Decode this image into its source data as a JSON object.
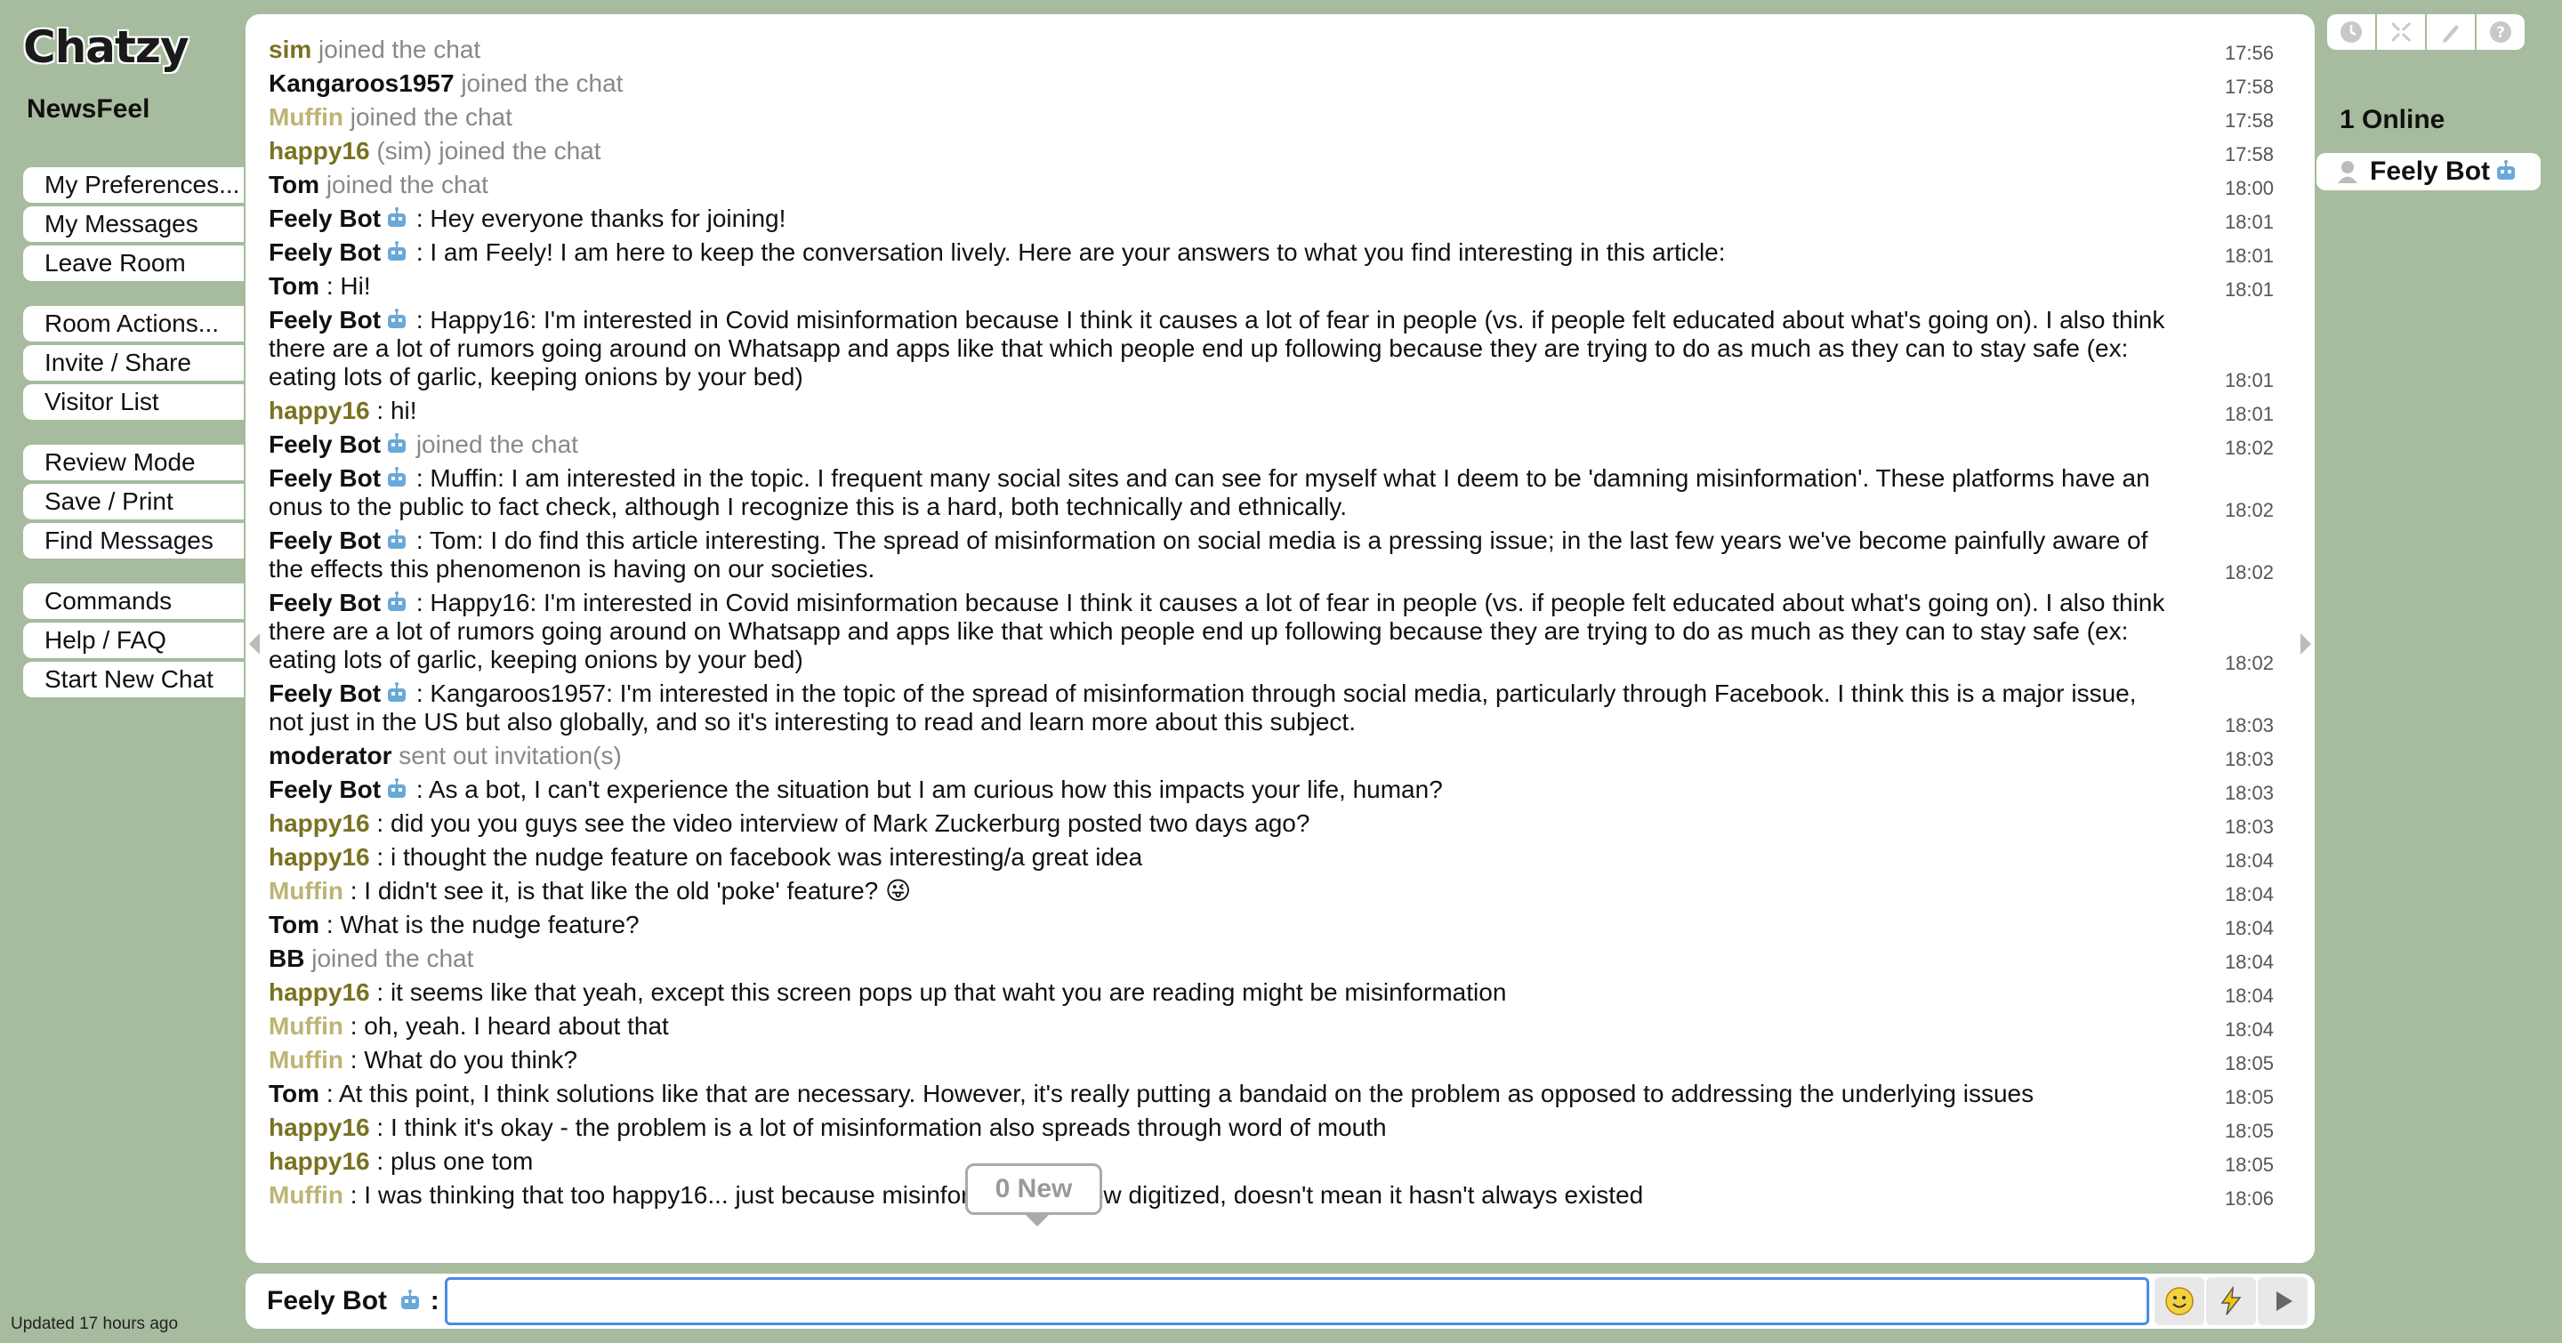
{
  "app": {
    "logo": "Chatzy",
    "room_name": "NewsFeel",
    "updated": "Updated 17 hours ago"
  },
  "sidebar": {
    "groups": [
      [
        "My Preferences...",
        "My Messages",
        "Leave Room"
      ],
      [
        "Room Actions...",
        "Invite / Share",
        "Visitor List"
      ],
      [
        "Review Mode",
        "Save / Print",
        "Find Messages"
      ],
      [
        "Commands",
        "Help / FAQ",
        "Start New Chat"
      ]
    ]
  },
  "chat": {
    "messages": [
      {
        "name": "sim",
        "cls": "n-sim",
        "text": "joined the chat",
        "system": true,
        "time": "17:56"
      },
      {
        "name": "Kangaroos1957",
        "cls": "n-kang",
        "text": "joined the chat",
        "system": true,
        "time": "17:58"
      },
      {
        "name": "Muffin",
        "cls": "n-muffin",
        "text": "joined the chat",
        "system": true,
        "time": "17:58"
      },
      {
        "name": "happy16",
        "cls": "n-happy16",
        "text": "(sim) joined the chat",
        "system": true,
        "time": "17:58"
      },
      {
        "name": "Tom",
        "cls": "n-tom",
        "text": "joined the chat",
        "system": true,
        "time": "18:00"
      },
      {
        "name": "Feely Bot",
        "cls": "bot",
        "bot": true,
        "text": " : Hey everyone thanks for joining!",
        "time": "18:01"
      },
      {
        "name": "Feely Bot",
        "cls": "bot",
        "bot": true,
        "text": " : I am Feely! I am here to keep the conversation lively. Here are your answers to what you find interesting in this article:",
        "time": "18:01"
      },
      {
        "name": "Tom",
        "cls": "n-tom",
        "text": ": Hi!",
        "time": "18:01"
      },
      {
        "name": "Feely Bot",
        "cls": "bot",
        "bot": true,
        "text": " : Happy16: I'm interested in Covid misinformation because I think it causes a lot of fear in people (vs. if people felt educated about what's going on). I also think there are a lot of rumors going around on Whatsapp and apps like that which people end up following because they are trying to do as much as they can to stay safe (ex: eating lots of garlic, keeping onions by your bed)",
        "time": "18:01"
      },
      {
        "name": "happy16",
        "cls": "n-happy16",
        "text": ": hi!",
        "time": "18:01"
      },
      {
        "name": "Feely Bot",
        "cls": "bot",
        "bot": true,
        "text": " joined the chat",
        "system": true,
        "time": "18:02"
      },
      {
        "name": "Feely Bot",
        "cls": "bot",
        "bot": true,
        "text": " : Muffin: I am interested in the topic. I frequent many social sites and can see for myself what I deem to be 'damning misinformation'. These platforms have an onus to the public to fact check, although I recognize this is a hard, both technically and ethnically.",
        "time": "18:02"
      },
      {
        "name": "Feely Bot",
        "cls": "bot",
        "bot": true,
        "text": " : Tom: I do find this article interesting. The spread of misinformation on social media is a pressing issue; in the last few years we've become painfully aware of the effects this phenomenon is having on our societies.",
        "time": "18:02"
      },
      {
        "name": "Feely Bot",
        "cls": "bot",
        "bot": true,
        "text": " : Happy16: I'm interested in Covid misinformation because I think it causes a lot of fear in people (vs. if people felt educated about what's going on). I also think there are a lot of rumors going around on Whatsapp and apps like that which people end up following because they are trying to do as much as they can to stay safe (ex: eating lots of garlic, keeping onions by your bed)",
        "time": "18:02"
      },
      {
        "name": "Feely Bot",
        "cls": "bot",
        "bot": true,
        "text": " : Kangaroos1957: I'm interested in the topic of the spread of misinformation through social media, particularly through Facebook. I think this is a major issue, not just in the US but also globally, and so it's interesting to read and learn more about this subject.",
        "time": "18:03"
      },
      {
        "name": "moderator",
        "cls": "n-mod",
        "text": "sent out invitation(s)",
        "system": true,
        "time": "18:03"
      },
      {
        "name": "Feely Bot",
        "cls": "bot",
        "bot": true,
        "text": " : As a bot, I can't experience the situation but I am curious how this impacts your life, human?",
        "time": "18:03"
      },
      {
        "name": "happy16",
        "cls": "n-happy16",
        "text": ": did you you guys see the video interview of Mark Zuckerburg posted two days ago?",
        "time": "18:03"
      },
      {
        "name": "happy16",
        "cls": "n-happy16",
        "text": ": i thought the nudge feature on facebook was interesting/a great idea",
        "time": "18:04"
      },
      {
        "name": "Muffin",
        "cls": "n-muffin",
        "text": ": I didn't see it, is that like the old 'poke' feature? 😜",
        "time": "18:04"
      },
      {
        "name": "Tom",
        "cls": "n-tom",
        "text": ": What is the nudge feature?",
        "time": "18:04"
      },
      {
        "name": "BB",
        "cls": "n-bb",
        "text": "joined the chat",
        "system": true,
        "time": "18:04"
      },
      {
        "name": "happy16",
        "cls": "n-happy16",
        "text": ": it seems like that yeah, except this screen pops up that waht you are reading might be misinformation",
        "time": "18:04"
      },
      {
        "name": "Muffin",
        "cls": "n-muffin",
        "text": ": oh, yeah. I heard about that",
        "time": "18:04"
      },
      {
        "name": "Muffin",
        "cls": "n-muffin",
        "text": ": What do you think?",
        "time": "18:05"
      },
      {
        "name": "Tom",
        "cls": "n-tom",
        "text": ": At this point, I think solutions like that are necessary. However, it's really putting a bandaid on the problem as opposed to addressing the underlying issues",
        "time": "18:05"
      },
      {
        "name": "happy16",
        "cls": "n-happy16",
        "text": ": I think it's okay - the problem is a lot of misinformation also spreads through word of mouth",
        "time": "18:05"
      },
      {
        "name": "happy16",
        "cls": "n-happy16",
        "text": ": plus one tom",
        "time": "18:05"
      },
      {
        "name": "Muffin",
        "cls": "n-muffin",
        "text": ": I was thinking that too happy16... just because misinformation is now digitized, doesn't mean it hasn't always existed",
        "time": "18:06"
      }
    ],
    "new_badge": "0 New"
  },
  "input": {
    "name": "Feely Bot",
    "separator": ":",
    "value": ""
  },
  "right": {
    "online_count": "1 Online",
    "online_user": "Feely Bot"
  },
  "icons": {
    "top": [
      "clock-icon",
      "collapse-icon",
      "pencil-icon",
      "help-icon"
    ],
    "input_tools": [
      "smiley-icon",
      "lightning-icon",
      "send-arrow-icon"
    ]
  }
}
